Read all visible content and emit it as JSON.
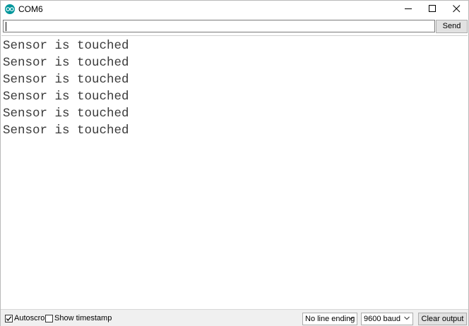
{
  "window": {
    "title": "COM6",
    "controls": {
      "minimize": "minimize",
      "maximize": "maximize",
      "close": "close"
    }
  },
  "input": {
    "value": "",
    "placeholder": ""
  },
  "send_label": "Send",
  "output_lines": [
    "Sensor is touched",
    "Sensor is touched",
    "Sensor is touched",
    "Sensor is touched",
    "Sensor is touched",
    "Sensor is touched"
  ],
  "bottom": {
    "autoscroll_label": "Autoscroll",
    "autoscroll_checked": true,
    "timestamp_label": "Show timestamp",
    "timestamp_checked": false,
    "line_ending": "No line ending",
    "baud": "9600 baud",
    "clear_label": "Clear output"
  },
  "colors": {
    "app_icon": "#00979c",
    "output_text": "#3a3a3a",
    "button_bg": "#e1e1e1"
  },
  "icons": [
    "app-icon",
    "minimize-icon",
    "maximize-icon",
    "close-icon",
    "checkmark-icon",
    "chevron-down-icon"
  ]
}
